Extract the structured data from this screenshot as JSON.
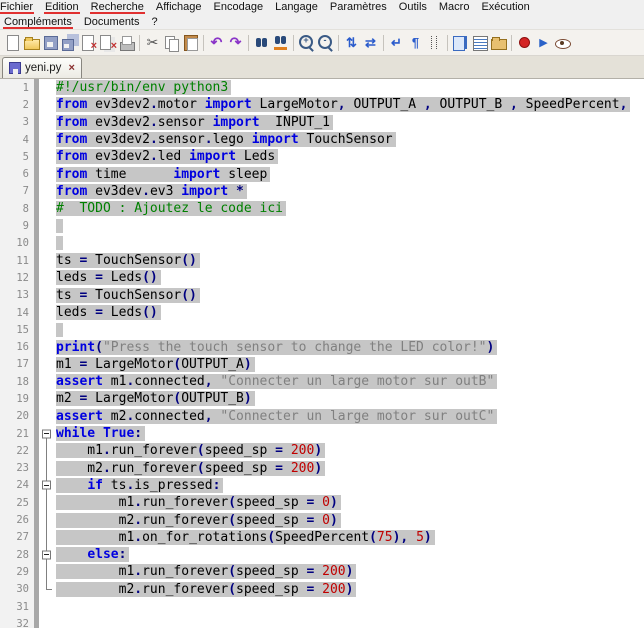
{
  "menubar": {
    "row1": [
      {
        "label": "Fichier",
        "underlined": true
      },
      {
        "label": "Edition",
        "underlined": true
      },
      {
        "label": "Recherche",
        "underlined": true
      },
      {
        "label": "Affichage",
        "underlined": false
      },
      {
        "label": "Encodage",
        "underlined": false
      },
      {
        "label": "Langage",
        "underlined": false
      },
      {
        "label": "Paramètres",
        "underlined": false
      },
      {
        "label": "Outils",
        "underlined": false
      },
      {
        "label": "Macro",
        "underlined": false
      },
      {
        "label": "Exécution",
        "underlined": false
      }
    ],
    "row2": [
      {
        "label": "Compléments",
        "underlined": true
      },
      {
        "label": "Documents",
        "underlined": false
      },
      {
        "label": "?",
        "underlined": false
      }
    ]
  },
  "toolbar": {
    "groups": [
      [
        "new-file-icon",
        "open-file-icon",
        "save-icon",
        "save-all-icon",
        "close-icon",
        "close-all-icon",
        "print-icon"
      ],
      [
        "cut-icon",
        "copy-icon",
        "paste-icon"
      ],
      [
        "undo-icon",
        "redo-icon"
      ],
      [
        "find-icon",
        "replace-icon"
      ],
      [
        "zoom-in-icon",
        "zoom-out-icon"
      ],
      [
        "sync-vertical-icon",
        "sync-horizontal-icon"
      ],
      [
        "word-wrap-icon",
        "show-all-characters-icon",
        "indent-guide-icon"
      ],
      [
        "document-map-icon",
        "function-list-icon",
        "folder-workspace-icon"
      ],
      [
        "record-macro-icon",
        "play-macro-icon",
        "monitor-icon"
      ]
    ]
  },
  "tab": {
    "label": "yeni.py",
    "close_glyph": "×",
    "state": "saved"
  },
  "editor": {
    "colors": {
      "keyword": "#0000E0",
      "comment": "#008000",
      "string": "#808080",
      "number": "#C00000",
      "operator": "#000080",
      "selection": "#C6C6C6",
      "line_number": "#8A8A8A"
    },
    "lines": [
      {
        "n": 1,
        "f": "",
        "s": true,
        "t": [
          [
            "c",
            "#!/usr/bin/env python3"
          ]
        ]
      },
      {
        "n": 2,
        "f": "",
        "s": true,
        "t": [
          [
            "k",
            "from"
          ],
          [
            "p",
            " ev3dev2"
          ],
          [
            "o",
            "."
          ],
          [
            "p",
            "motor "
          ],
          [
            "k",
            "import"
          ],
          [
            "p",
            " LargeMotor"
          ],
          [
            "o",
            ","
          ],
          [
            "p",
            " OUTPUT_A "
          ],
          [
            "o",
            ","
          ],
          [
            "p",
            " OUTPUT_B "
          ],
          [
            "o",
            ","
          ],
          [
            "p",
            " SpeedPercent"
          ],
          [
            "o",
            ","
          ]
        ]
      },
      {
        "n": 3,
        "f": "",
        "s": true,
        "t": [
          [
            "k",
            "from"
          ],
          [
            "p",
            " ev3dev2"
          ],
          [
            "o",
            "."
          ],
          [
            "p",
            "sensor "
          ],
          [
            "k",
            "import"
          ],
          [
            "p",
            "  INPUT_1"
          ]
        ]
      },
      {
        "n": 4,
        "f": "",
        "s": true,
        "t": [
          [
            "k",
            "from"
          ],
          [
            "p",
            " ev3dev2"
          ],
          [
            "o",
            "."
          ],
          [
            "p",
            "sensor"
          ],
          [
            "o",
            "."
          ],
          [
            "p",
            "lego "
          ],
          [
            "k",
            "import"
          ],
          [
            "p",
            " TouchSensor"
          ]
        ]
      },
      {
        "n": 5,
        "f": "",
        "s": true,
        "t": [
          [
            "k",
            "from"
          ],
          [
            "p",
            " ev3dev2"
          ],
          [
            "o",
            "."
          ],
          [
            "p",
            "led "
          ],
          [
            "k",
            "import"
          ],
          [
            "p",
            " Leds"
          ]
        ]
      },
      {
        "n": 6,
        "f": "",
        "s": true,
        "t": [
          [
            "k",
            "from"
          ],
          [
            "p",
            " time      "
          ],
          [
            "k",
            "import"
          ],
          [
            "p",
            " sleep"
          ]
        ]
      },
      {
        "n": 7,
        "f": "",
        "s": true,
        "t": [
          [
            "k",
            "from"
          ],
          [
            "p",
            " ev3dev"
          ],
          [
            "o",
            "."
          ],
          [
            "p",
            "ev3 "
          ],
          [
            "k",
            "import"
          ],
          [
            "p",
            " "
          ],
          [
            "o",
            "*"
          ]
        ]
      },
      {
        "n": 8,
        "f": "",
        "s": true,
        "t": [
          [
            "c",
            "#  TODO : Ajoutez le code ici"
          ]
        ]
      },
      {
        "n": 9,
        "f": "",
        "s": true,
        "t": []
      },
      {
        "n": 10,
        "f": "",
        "s": true,
        "t": []
      },
      {
        "n": 11,
        "f": "",
        "s": true,
        "t": [
          [
            "p",
            "ts "
          ],
          [
            "o",
            "="
          ],
          [
            "p",
            " TouchSensor"
          ],
          [
            "o",
            "()"
          ]
        ]
      },
      {
        "n": 12,
        "f": "",
        "s": true,
        "t": [
          [
            "p",
            "leds "
          ],
          [
            "o",
            "="
          ],
          [
            "p",
            " Leds"
          ],
          [
            "o",
            "()"
          ]
        ]
      },
      {
        "n": 13,
        "f": "",
        "s": true,
        "t": [
          [
            "p",
            "ts "
          ],
          [
            "o",
            "="
          ],
          [
            "p",
            " TouchSensor"
          ],
          [
            "o",
            "()"
          ]
        ]
      },
      {
        "n": 14,
        "f": "",
        "s": true,
        "t": [
          [
            "p",
            "leds "
          ],
          [
            "o",
            "="
          ],
          [
            "p",
            " Leds"
          ],
          [
            "o",
            "()"
          ]
        ]
      },
      {
        "n": 15,
        "f": "",
        "s": true,
        "t": []
      },
      {
        "n": 16,
        "f": "",
        "s": true,
        "t": [
          [
            "k",
            "print"
          ],
          [
            "o",
            "("
          ],
          [
            "s",
            "\"Press the touch sensor to change the LED color!\""
          ],
          [
            "o",
            ")"
          ]
        ]
      },
      {
        "n": 17,
        "f": "",
        "s": true,
        "t": [
          [
            "p",
            "m1 "
          ],
          [
            "o",
            "="
          ],
          [
            "p",
            " LargeMotor"
          ],
          [
            "o",
            "("
          ],
          [
            "p",
            "OUTPUT_A"
          ],
          [
            "o",
            ")"
          ]
        ]
      },
      {
        "n": 18,
        "f": "",
        "s": true,
        "t": [
          [
            "k",
            "assert"
          ],
          [
            "p",
            " m1"
          ],
          [
            "o",
            "."
          ],
          [
            "p",
            "connected"
          ],
          [
            "o",
            ","
          ],
          [
            "p",
            " "
          ],
          [
            "s",
            "\"Connecter un large motor sur outB\""
          ]
        ]
      },
      {
        "n": 19,
        "f": "",
        "s": true,
        "t": [
          [
            "p",
            "m2 "
          ],
          [
            "o",
            "="
          ],
          [
            "p",
            " LargeMotor"
          ],
          [
            "o",
            "("
          ],
          [
            "p",
            "OUTPUT_B"
          ],
          [
            "o",
            ")"
          ]
        ]
      },
      {
        "n": 20,
        "f": "",
        "s": true,
        "t": [
          [
            "k",
            "assert"
          ],
          [
            "p",
            " m2"
          ],
          [
            "o",
            "."
          ],
          [
            "p",
            "connected"
          ],
          [
            "o",
            ","
          ],
          [
            "p",
            " "
          ],
          [
            "s",
            "\"Connecter un large motor sur outC\""
          ]
        ]
      },
      {
        "n": 21,
        "f": "open-first",
        "s": true,
        "t": [
          [
            "k",
            "while"
          ],
          [
            "p",
            " "
          ],
          [
            "k",
            "True"
          ],
          [
            "o",
            ":"
          ]
        ]
      },
      {
        "n": 22,
        "f": "line",
        "s": true,
        "t": [
          [
            "p",
            "    m1"
          ],
          [
            "o",
            "."
          ],
          [
            "p",
            "run_forever"
          ],
          [
            "o",
            "("
          ],
          [
            "p",
            "speed_sp "
          ],
          [
            "o",
            "="
          ],
          [
            "p",
            " "
          ],
          [
            "n",
            "200"
          ],
          [
            "o",
            ")"
          ]
        ]
      },
      {
        "n": 23,
        "f": "line",
        "s": true,
        "t": [
          [
            "p",
            "    m2"
          ],
          [
            "o",
            "."
          ],
          [
            "p",
            "run_forever"
          ],
          [
            "o",
            "("
          ],
          [
            "p",
            "speed_sp "
          ],
          [
            "o",
            "="
          ],
          [
            "p",
            " "
          ],
          [
            "n",
            "200"
          ],
          [
            "o",
            ")"
          ]
        ]
      },
      {
        "n": 24,
        "f": "open",
        "s": true,
        "t": [
          [
            "p",
            "    "
          ],
          [
            "k",
            "if"
          ],
          [
            "p",
            " ts"
          ],
          [
            "o",
            "."
          ],
          [
            "p",
            "is_pressed"
          ],
          [
            "o",
            ":"
          ]
        ]
      },
      {
        "n": 25,
        "f": "line",
        "s": true,
        "t": [
          [
            "p",
            "        m1"
          ],
          [
            "o",
            "."
          ],
          [
            "p",
            "run_forever"
          ],
          [
            "o",
            "("
          ],
          [
            "p",
            "speed_sp "
          ],
          [
            "o",
            "="
          ],
          [
            "p",
            " "
          ],
          [
            "n",
            "0"
          ],
          [
            "o",
            ")"
          ]
        ]
      },
      {
        "n": 26,
        "f": "line",
        "s": true,
        "t": [
          [
            "p",
            "        m2"
          ],
          [
            "o",
            "."
          ],
          [
            "p",
            "run_forever"
          ],
          [
            "o",
            "("
          ],
          [
            "p",
            "speed_sp "
          ],
          [
            "o",
            "="
          ],
          [
            "p",
            " "
          ],
          [
            "n",
            "0"
          ],
          [
            "o",
            ")"
          ]
        ]
      },
      {
        "n": 27,
        "f": "line",
        "s": true,
        "t": [
          [
            "p",
            "        m1"
          ],
          [
            "o",
            "."
          ],
          [
            "p",
            "on_for_rotations"
          ],
          [
            "o",
            "("
          ],
          [
            "p",
            "SpeedPercent"
          ],
          [
            "o",
            "("
          ],
          [
            "n",
            "75"
          ],
          [
            "o",
            ")"
          ],
          [
            "o",
            ","
          ],
          [
            "p",
            " "
          ],
          [
            "n",
            "5"
          ],
          [
            "o",
            ")"
          ]
        ]
      },
      {
        "n": 28,
        "f": "open",
        "s": true,
        "t": [
          [
            "p",
            "    "
          ],
          [
            "k",
            "else"
          ],
          [
            "o",
            ":"
          ]
        ]
      },
      {
        "n": 29,
        "f": "line",
        "s": true,
        "t": [
          [
            "p",
            "        m1"
          ],
          [
            "o",
            "."
          ],
          [
            "p",
            "run_forever"
          ],
          [
            "o",
            "("
          ],
          [
            "p",
            "speed_sp "
          ],
          [
            "o",
            "="
          ],
          [
            "p",
            " "
          ],
          [
            "n",
            "200"
          ],
          [
            "o",
            ")"
          ]
        ]
      },
      {
        "n": 30,
        "f": "end",
        "s": true,
        "t": [
          [
            "p",
            "        m2"
          ],
          [
            "o",
            "."
          ],
          [
            "p",
            "run_forever"
          ],
          [
            "o",
            "("
          ],
          [
            "p",
            "speed_sp "
          ],
          [
            "o",
            "="
          ],
          [
            "p",
            " "
          ],
          [
            "n",
            "200"
          ],
          [
            "o",
            ")"
          ]
        ]
      },
      {
        "n": 31,
        "f": "",
        "s": false,
        "t": []
      },
      {
        "n": 32,
        "f": "",
        "s": false,
        "t": []
      }
    ]
  }
}
